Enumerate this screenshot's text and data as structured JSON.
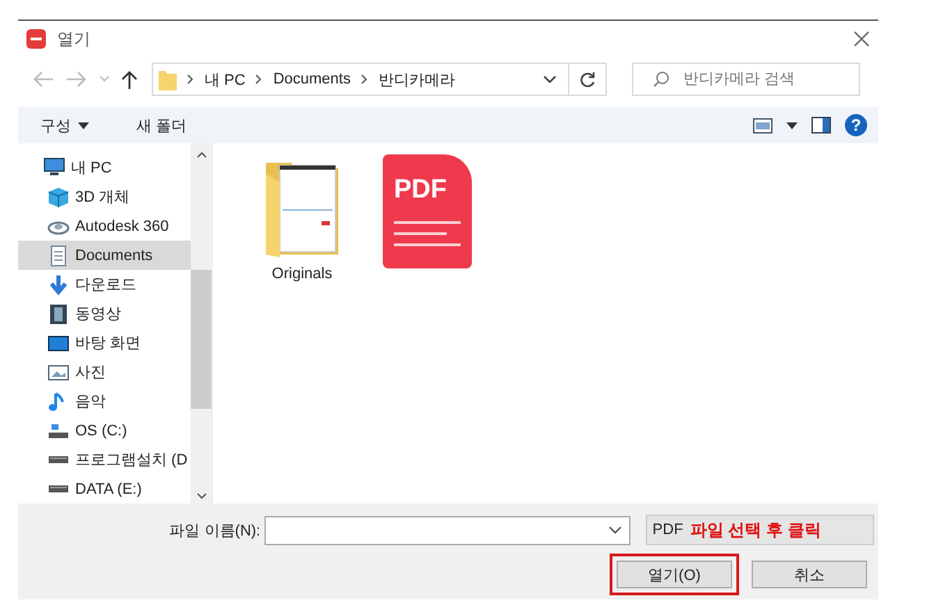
{
  "window": {
    "title": "열기"
  },
  "navigation": {
    "path": [
      "내 PC",
      "Documents",
      "반디카메라"
    ]
  },
  "search": {
    "placeholder": "반디카메라 검색"
  },
  "toolbar": {
    "items": [
      {
        "label": "구성",
        "dropdown": true
      },
      {
        "label": "새 폴더",
        "dropdown": false
      }
    ],
    "help": "?"
  },
  "sidebar": {
    "items": [
      {
        "label": "내 PC",
        "kind": "pc",
        "selected": false,
        "children": [
          {
            "label": "3D 개체",
            "kind": "cube",
            "selected": false
          },
          {
            "label": "Autodesk 360",
            "kind": "cloud",
            "selected": false
          },
          {
            "label": "Documents",
            "kind": "document",
            "selected": true
          },
          {
            "label": "다운로드",
            "kind": "download",
            "selected": false
          },
          {
            "label": "동영상",
            "kind": "film",
            "selected": false
          },
          {
            "label": "바탕 화면",
            "kind": "desktop",
            "selected": false
          },
          {
            "label": "사진",
            "kind": "picture",
            "selected": false
          },
          {
            "label": "음악",
            "kind": "music",
            "selected": false
          },
          {
            "label": "OS (C:)",
            "kind": "system-drive",
            "selected": false
          },
          {
            "label": "프로그램설치 (D",
            "kind": "drive",
            "selected": false
          },
          {
            "label": "DATA (E:)",
            "kind": "drive",
            "selected": false
          }
        ]
      }
    ]
  },
  "files": [
    {
      "kind": "folder",
      "name": "Originals"
    },
    {
      "kind": "pdf",
      "badge": "PDF"
    }
  ],
  "footer": {
    "filename_label": "파일 이름(N):",
    "filetype": "PDF",
    "annotation": "파일 선택 후 클릭",
    "buttons": [
      {
        "label": "열기(O)",
        "highlighted": true
      },
      {
        "label": "취소",
        "highlighted": false
      }
    ]
  }
}
